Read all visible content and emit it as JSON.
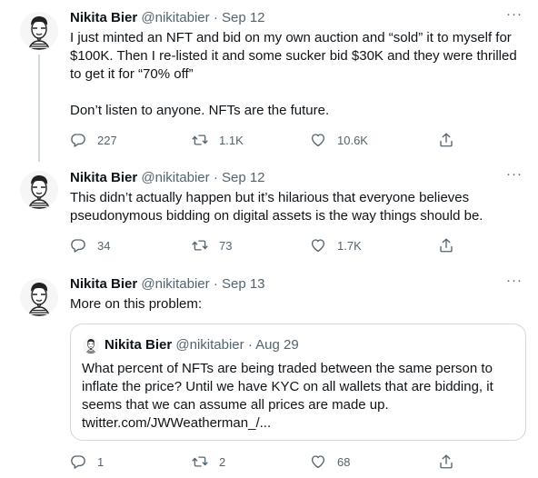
{
  "colors": {
    "text": "#0f1419",
    "secondary": "#536471",
    "border": "#cfd9de"
  },
  "tweets": [
    {
      "name": "Nikita Bier",
      "handle": "@nikitabier",
      "sep": "·",
      "date": "Sep 12",
      "more": "···",
      "text": "I just minted an NFT and bid on my own auction and “sold” it to myself for $100K. Then I re-listed it and some sucker bid $30K and they were thrilled to get it for “70% off”\n\nDon’t listen to anyone. NFTs are the future.",
      "replies": "227",
      "retweets": "1.1K",
      "likes": "10.6K"
    },
    {
      "name": "Nikita Bier",
      "handle": "@nikitabier",
      "sep": "·",
      "date": "Sep 12",
      "more": "···",
      "text": "This didn’t actually happen but it’s hilarious that everyone believes pseudonymous bidding on digital assets is the way things should be.",
      "replies": "34",
      "retweets": "73",
      "likes": "1.7K"
    },
    {
      "name": "Nikita Bier",
      "handle": "@nikitabier",
      "sep": "·",
      "date": "Sep 13",
      "more": "···",
      "text": "More on this problem:",
      "replies": "1",
      "retweets": "2",
      "likes": "68",
      "quote": {
        "name": "Nikita Bier",
        "handle": "@nikitabier",
        "sep": "·",
        "date": "Aug 29",
        "text": "What percent of NFTs are being traded between the same person to inflate the price? Until we have KYC on all wallets that are bidding, it seems that we can assume all prices are made up.\ntwitter.com/JWWeatherman_/..."
      }
    }
  ],
  "icons": [
    "reply-icon",
    "retweet-icon",
    "like-icon",
    "share-icon",
    "more-icon",
    "avatar"
  ]
}
